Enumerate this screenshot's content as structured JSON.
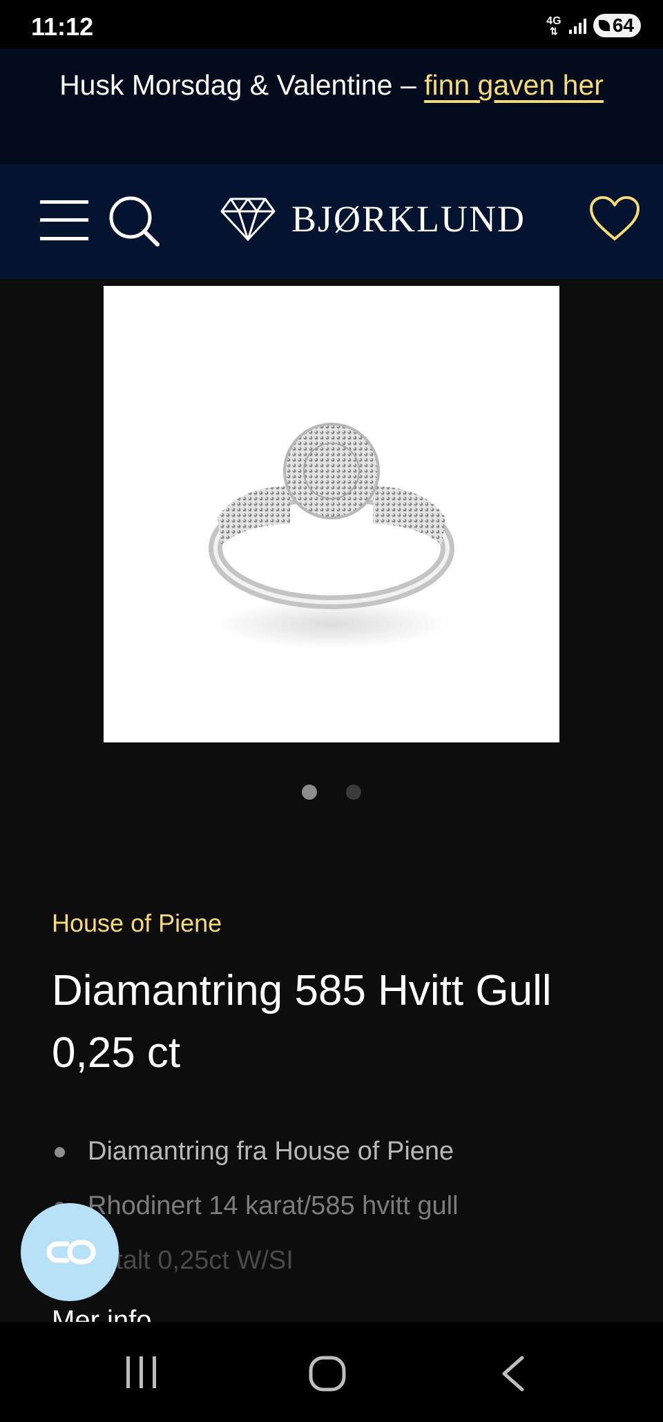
{
  "status_bar": {
    "time": "11:12",
    "network": "4G",
    "battery": "64"
  },
  "promo_banner": {
    "text": "Husk Morsdag & Valentine –",
    "link": "finn gaven her",
    "link_color": "#f6dc72"
  },
  "header": {
    "logo_text": "BJØRKLUND",
    "menu_icon": "hamburger-icon",
    "search_icon": "search-icon",
    "logo_icon": "diamond-icon",
    "favorites_icon": "heart-icon",
    "accent_color": "#f6dc72",
    "background": "#04132f"
  },
  "product": {
    "image": "white gold diamond cluster ring",
    "gallery": {
      "total_slides": 2,
      "active_slide": 1
    },
    "brand": "House of Piene",
    "title": "Diamantring 585 Hvitt Gull 0,25 ct",
    "features": [
      "Diamantring fra House of Piene",
      "Rhodinert 14 karat/585 hvitt gull",
      "Totalt 0,25ct W/SI"
    ],
    "more_info": "Mer info"
  },
  "chat_button": {
    "icon": "chat-link-icon",
    "color": "#b7e1f7"
  },
  "system_nav": {
    "recent": "recent-apps-icon",
    "home": "home-icon",
    "back": "back-icon"
  }
}
